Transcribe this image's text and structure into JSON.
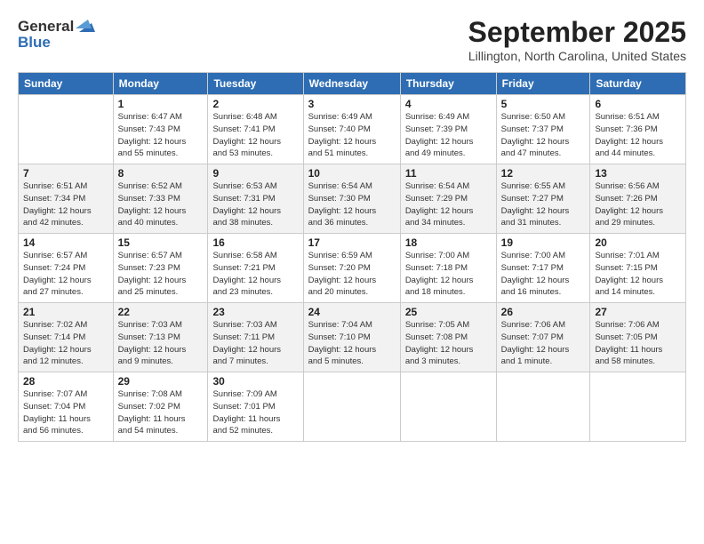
{
  "header": {
    "logo_line1": "General",
    "logo_line2": "Blue",
    "month_title": "September 2025",
    "location": "Lillington, North Carolina, United States"
  },
  "columns": [
    "Sunday",
    "Monday",
    "Tuesday",
    "Wednesday",
    "Thursday",
    "Friday",
    "Saturday"
  ],
  "weeks": [
    [
      {
        "day": "",
        "info": ""
      },
      {
        "day": "1",
        "info": "Sunrise: 6:47 AM\nSunset: 7:43 PM\nDaylight: 12 hours\nand 55 minutes."
      },
      {
        "day": "2",
        "info": "Sunrise: 6:48 AM\nSunset: 7:41 PM\nDaylight: 12 hours\nand 53 minutes."
      },
      {
        "day": "3",
        "info": "Sunrise: 6:49 AM\nSunset: 7:40 PM\nDaylight: 12 hours\nand 51 minutes."
      },
      {
        "day": "4",
        "info": "Sunrise: 6:49 AM\nSunset: 7:39 PM\nDaylight: 12 hours\nand 49 minutes."
      },
      {
        "day": "5",
        "info": "Sunrise: 6:50 AM\nSunset: 7:37 PM\nDaylight: 12 hours\nand 47 minutes."
      },
      {
        "day": "6",
        "info": "Sunrise: 6:51 AM\nSunset: 7:36 PM\nDaylight: 12 hours\nand 44 minutes."
      }
    ],
    [
      {
        "day": "7",
        "info": "Sunrise: 6:51 AM\nSunset: 7:34 PM\nDaylight: 12 hours\nand 42 minutes."
      },
      {
        "day": "8",
        "info": "Sunrise: 6:52 AM\nSunset: 7:33 PM\nDaylight: 12 hours\nand 40 minutes."
      },
      {
        "day": "9",
        "info": "Sunrise: 6:53 AM\nSunset: 7:31 PM\nDaylight: 12 hours\nand 38 minutes."
      },
      {
        "day": "10",
        "info": "Sunrise: 6:54 AM\nSunset: 7:30 PM\nDaylight: 12 hours\nand 36 minutes."
      },
      {
        "day": "11",
        "info": "Sunrise: 6:54 AM\nSunset: 7:29 PM\nDaylight: 12 hours\nand 34 minutes."
      },
      {
        "day": "12",
        "info": "Sunrise: 6:55 AM\nSunset: 7:27 PM\nDaylight: 12 hours\nand 31 minutes."
      },
      {
        "day": "13",
        "info": "Sunrise: 6:56 AM\nSunset: 7:26 PM\nDaylight: 12 hours\nand 29 minutes."
      }
    ],
    [
      {
        "day": "14",
        "info": "Sunrise: 6:57 AM\nSunset: 7:24 PM\nDaylight: 12 hours\nand 27 minutes."
      },
      {
        "day": "15",
        "info": "Sunrise: 6:57 AM\nSunset: 7:23 PM\nDaylight: 12 hours\nand 25 minutes."
      },
      {
        "day": "16",
        "info": "Sunrise: 6:58 AM\nSunset: 7:21 PM\nDaylight: 12 hours\nand 23 minutes."
      },
      {
        "day": "17",
        "info": "Sunrise: 6:59 AM\nSunset: 7:20 PM\nDaylight: 12 hours\nand 20 minutes."
      },
      {
        "day": "18",
        "info": "Sunrise: 7:00 AM\nSunset: 7:18 PM\nDaylight: 12 hours\nand 18 minutes."
      },
      {
        "day": "19",
        "info": "Sunrise: 7:00 AM\nSunset: 7:17 PM\nDaylight: 12 hours\nand 16 minutes."
      },
      {
        "day": "20",
        "info": "Sunrise: 7:01 AM\nSunset: 7:15 PM\nDaylight: 12 hours\nand 14 minutes."
      }
    ],
    [
      {
        "day": "21",
        "info": "Sunrise: 7:02 AM\nSunset: 7:14 PM\nDaylight: 12 hours\nand 12 minutes."
      },
      {
        "day": "22",
        "info": "Sunrise: 7:03 AM\nSunset: 7:13 PM\nDaylight: 12 hours\nand 9 minutes."
      },
      {
        "day": "23",
        "info": "Sunrise: 7:03 AM\nSunset: 7:11 PM\nDaylight: 12 hours\nand 7 minutes."
      },
      {
        "day": "24",
        "info": "Sunrise: 7:04 AM\nSunset: 7:10 PM\nDaylight: 12 hours\nand 5 minutes."
      },
      {
        "day": "25",
        "info": "Sunrise: 7:05 AM\nSunset: 7:08 PM\nDaylight: 12 hours\nand 3 minutes."
      },
      {
        "day": "26",
        "info": "Sunrise: 7:06 AM\nSunset: 7:07 PM\nDaylight: 12 hours\nand 1 minute."
      },
      {
        "day": "27",
        "info": "Sunrise: 7:06 AM\nSunset: 7:05 PM\nDaylight: 11 hours\nand 58 minutes."
      }
    ],
    [
      {
        "day": "28",
        "info": "Sunrise: 7:07 AM\nSunset: 7:04 PM\nDaylight: 11 hours\nand 56 minutes."
      },
      {
        "day": "29",
        "info": "Sunrise: 7:08 AM\nSunset: 7:02 PM\nDaylight: 11 hours\nand 54 minutes."
      },
      {
        "day": "30",
        "info": "Sunrise: 7:09 AM\nSunset: 7:01 PM\nDaylight: 11 hours\nand 52 minutes."
      },
      {
        "day": "",
        "info": ""
      },
      {
        "day": "",
        "info": ""
      },
      {
        "day": "",
        "info": ""
      },
      {
        "day": "",
        "info": ""
      }
    ]
  ]
}
